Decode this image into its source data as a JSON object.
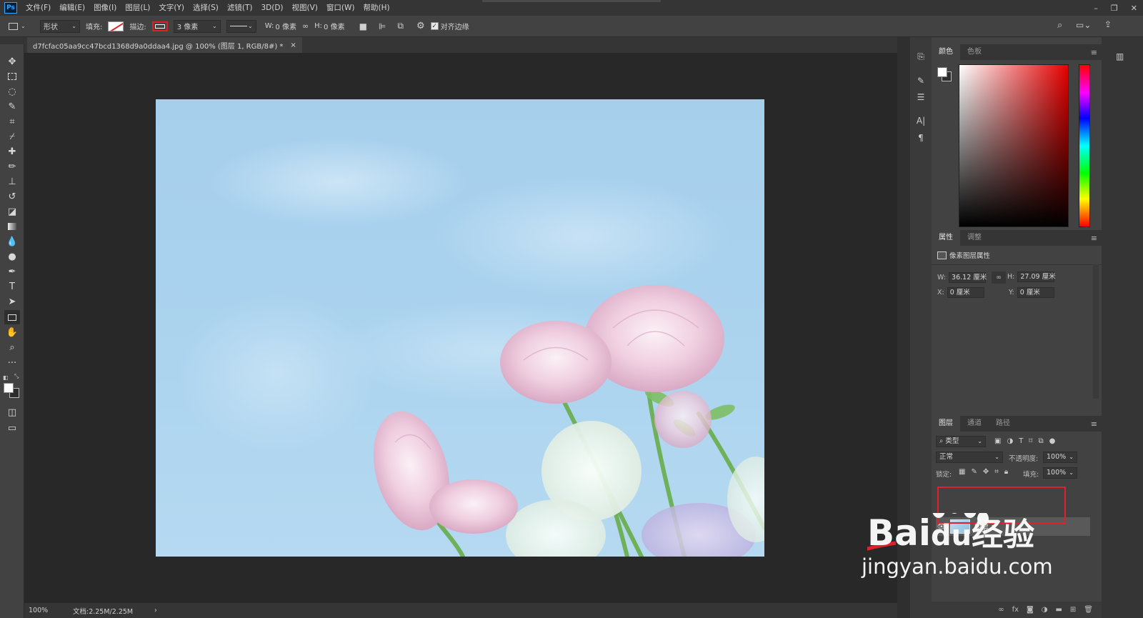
{
  "app": {
    "logo": "Ps"
  },
  "menu": [
    "文件(F)",
    "编辑(E)",
    "图像(I)",
    "图层(L)",
    "文字(Y)",
    "选择(S)",
    "滤镜(T)",
    "3D(D)",
    "视图(V)",
    "窗口(W)",
    "帮助(H)"
  ],
  "options": {
    "mode": "形状",
    "fill_label": "填充:",
    "stroke_label": "描边:",
    "stroke_width": "3 像素",
    "w_label": "W:",
    "w_value": "0 像素",
    "h_label": "H:",
    "h_value": "0 像素",
    "align_edges": "对齐边缘"
  },
  "document": {
    "tab_title": "d7fcfac05aa9cc47bcd1368d9a0ddaa4.jpg @ 100% (图层 1, RGB/8#) *",
    "close": "×"
  },
  "status": {
    "zoom": "100%",
    "doc_size": "文档:2.25M/2.25M",
    "arrow": "›"
  },
  "color_panel": {
    "tabs": [
      "颜色",
      "色板"
    ]
  },
  "properties_panel": {
    "tabs": [
      "属性",
      "调整"
    ],
    "header": "像素图层属性",
    "w_label": "W:",
    "w_value": "36.12 厘米",
    "h_label": "H:",
    "h_value": "27.09 厘米",
    "x_label": "X:",
    "x_value": "0 厘米",
    "y_label": "Y:",
    "y_value": "0 厘米"
  },
  "layers_panel": {
    "tabs": [
      "图层",
      "通道",
      "路径"
    ],
    "filter_type": "类型",
    "blend_mode": "正常",
    "opacity_label": "不透明度:",
    "opacity_value": "100%",
    "lock_label": "锁定:",
    "fill_label": "填充:",
    "fill_value": "100%",
    "layers": [
      {
        "name": "图层 1",
        "visible": true
      }
    ]
  },
  "watermark": {
    "brand": "Bai",
    "brand_suffix": "经验",
    "url": "jingyan.baidu.com"
  },
  "colors": {
    "accent": "#31a8ff",
    "highlight": "#e0202a"
  }
}
